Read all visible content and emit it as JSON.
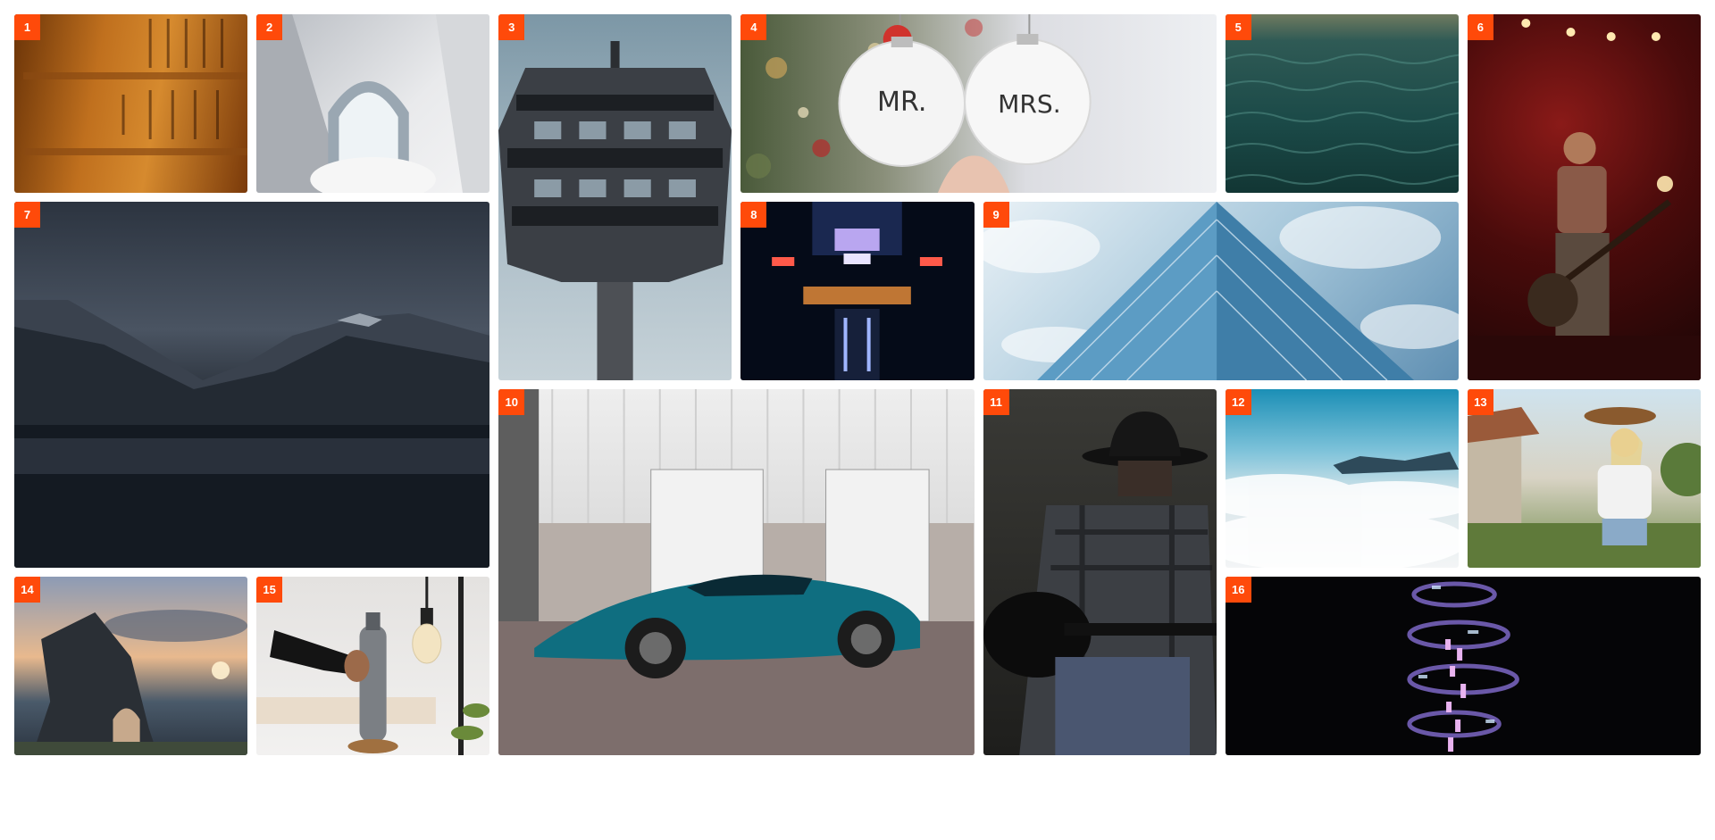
{
  "gallery": {
    "tiles": [
      {
        "number": "1",
        "subject": "wooden plaques with engraved characters"
      },
      {
        "number": "2",
        "subject": "white modern building arch"
      },
      {
        "number": "3",
        "subject": "retro observation tower"
      },
      {
        "number": "4",
        "subject": "christmas ornaments mr and mrs",
        "ornament_left": "MR.",
        "ornament_right": "MRS."
      },
      {
        "number": "5",
        "subject": "dark green ocean waves"
      },
      {
        "number": "6",
        "subject": "bass guitarist on red lit stage"
      },
      {
        "number": "7",
        "subject": "mountain lake under stormy clouds"
      },
      {
        "number": "8",
        "subject": "symmetric night city lights"
      },
      {
        "number": "9",
        "subject": "glass skyscraper against clouds"
      },
      {
        "number": "10",
        "subject": "teal sports car in front of garage"
      },
      {
        "number": "11",
        "subject": "guitarist in hat"
      },
      {
        "number": "12",
        "subject": "sea of clouds from above"
      },
      {
        "number": "13",
        "subject": "woman holding hat"
      },
      {
        "number": "14",
        "subject": "sea stack arch at sunset"
      },
      {
        "number": "15",
        "subject": "hand holding steel bottle"
      },
      {
        "number": "16",
        "subject": "neon spiral sculpture"
      }
    ]
  },
  "colors": {
    "badge": "#ff4a0a",
    "badge_text": "#ffffff",
    "page_bg": "#ffffff"
  }
}
